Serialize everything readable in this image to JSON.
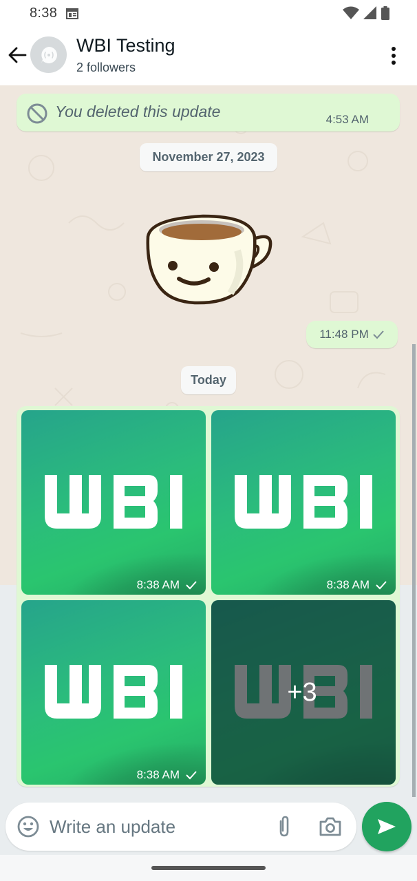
{
  "status_bar": {
    "time": "8:38",
    "icons": [
      "calendar-icon",
      "wifi-icon",
      "signal-icon",
      "battery-icon"
    ]
  },
  "header": {
    "title": "WBI Testing",
    "subtitle": "2 followers",
    "back_icon": "arrow-left-icon",
    "avatar_icon": "channel-icon",
    "menu_icon": "more-vert-icon"
  },
  "messages": {
    "deleted": {
      "text": "You deleted this update",
      "time": "4:53 AM",
      "icon": "blocked-icon"
    },
    "date_nov": "November 27, 2023",
    "sticker": {
      "name": "smiling-coffee-cup-sticker",
      "time": "11:48 PM",
      "status_icon": "single-check-icon"
    },
    "date_today": "Today",
    "album": {
      "tiles": [
        {
          "label": "WBI",
          "time": "8:38 AM"
        },
        {
          "label": "WBI",
          "time": "8:38 AM"
        },
        {
          "label": "WBI",
          "time": "8:38 AM"
        },
        {
          "label": "WBI",
          "more": "+3"
        }
      ]
    }
  },
  "composer": {
    "placeholder": "Write an update",
    "value": "",
    "emoji_icon": "emoji-icon",
    "attach_icon": "paperclip-icon",
    "camera_icon": "camera-icon",
    "send_icon": "send-icon"
  },
  "colors": {
    "accent": "#21a35f",
    "outgoing_bubble": "#dff8d4",
    "wallpaper": "#efe7de",
    "chat_gray": "#e9edef"
  }
}
